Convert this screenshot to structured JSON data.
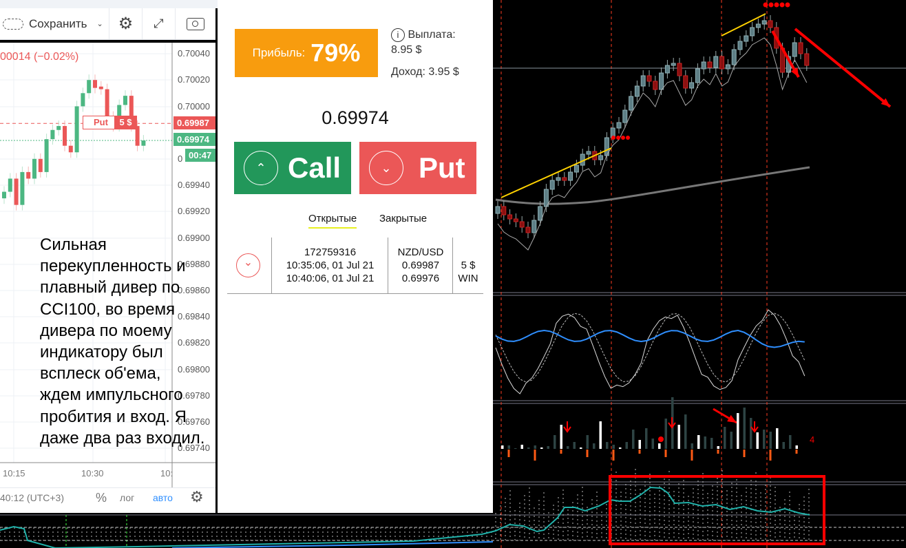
{
  "toolbar": {
    "save_label": "Сохранить"
  },
  "left_chart": {
    "change": "00014 (−0.02%)",
    "price_labels": [
      "0.70040",
      "0.70020",
      "0.70000",
      "0",
      "0.69940",
      "0.69920",
      "0.69900",
      "0.69880",
      "0.69860",
      "0.69840",
      "0.69820",
      "0.69800",
      "0.69780",
      "0.69760",
      "0.69740"
    ],
    "put_marker": "Put",
    "put_amount": "5 $",
    "open_price_tag": "0.69987",
    "current_price_tag": "0.69974",
    "timer": "00:47",
    "time_labels": [
      "10:15",
      "10:30",
      "10:"
    ],
    "time_text": "40:12 (UTC+3)",
    "percent": "%",
    "log": "лог",
    "auto": "авто"
  },
  "note": "Сильная перекупленность и плавный дивер по CCI100, во время дивера по моему индикатору был всплеск об'ема, ждем импульсного пробития и вход. Я даже два раз входил.",
  "trade": {
    "profit_label": "Прибыль:",
    "profit_value": "79%",
    "payout_label": "Выплата:",
    "payout_value": "8.95 $",
    "income": "Доход: 3.95 $",
    "current_price": "0.69974",
    "call_label": "Call",
    "put_label": "Put",
    "tabs": [
      "Открытые",
      "Закрытые"
    ],
    "deal": {
      "id": "172759316",
      "open_time": "10:35:06, 01 Jul 21",
      "close_time": "10:40:06, 01 Jul 21",
      "pair": "NZD/USD",
      "open_price": "0.69987",
      "close_price": "0.69976",
      "amount": "5 $",
      "result": "WIN"
    }
  },
  "mt4": {
    "volume_label": "4"
  },
  "colors": {
    "green": "#22975a",
    "red": "#eb5757",
    "orange": "#f89c0e",
    "teal": "#20b2aa",
    "blue": "#2f8fff"
  },
  "chart_data": {
    "type": "candlestick",
    "candles": [
      [
        0.6993,
        0.69935
      ],
      [
        0.69935,
        0.69945
      ],
      [
        0.69945,
        0.69925
      ],
      [
        0.69925,
        0.6995
      ],
      [
        0.6995,
        0.69945
      ],
      [
        0.69945,
        0.6996
      ],
      [
        0.6996,
        0.6995
      ],
      [
        0.6995,
        0.69975
      ],
      [
        0.69975,
        0.69982
      ],
      [
        0.69982,
        0.69985
      ],
      [
        0.69985,
        0.6997
      ],
      [
        0.6997,
        0.69965
      ],
      [
        0.69965,
        0.7
      ],
      [
        0.7,
        0.7001
      ],
      [
        0.7001,
        0.7002
      ],
      [
        0.7002,
        0.70014
      ],
      [
        0.70015,
        0.70013
      ],
      [
        0.70013,
        0.69992
      ],
      [
        0.69992,
        0.69985
      ],
      [
        0.69985,
        0.70001
      ],
      [
        0.70001,
        0.70008
      ],
      [
        0.70008,
        0.69985
      ],
      [
        0.69985,
        0.6997
      ],
      [
        0.6997,
        0.69974
      ]
    ]
  }
}
